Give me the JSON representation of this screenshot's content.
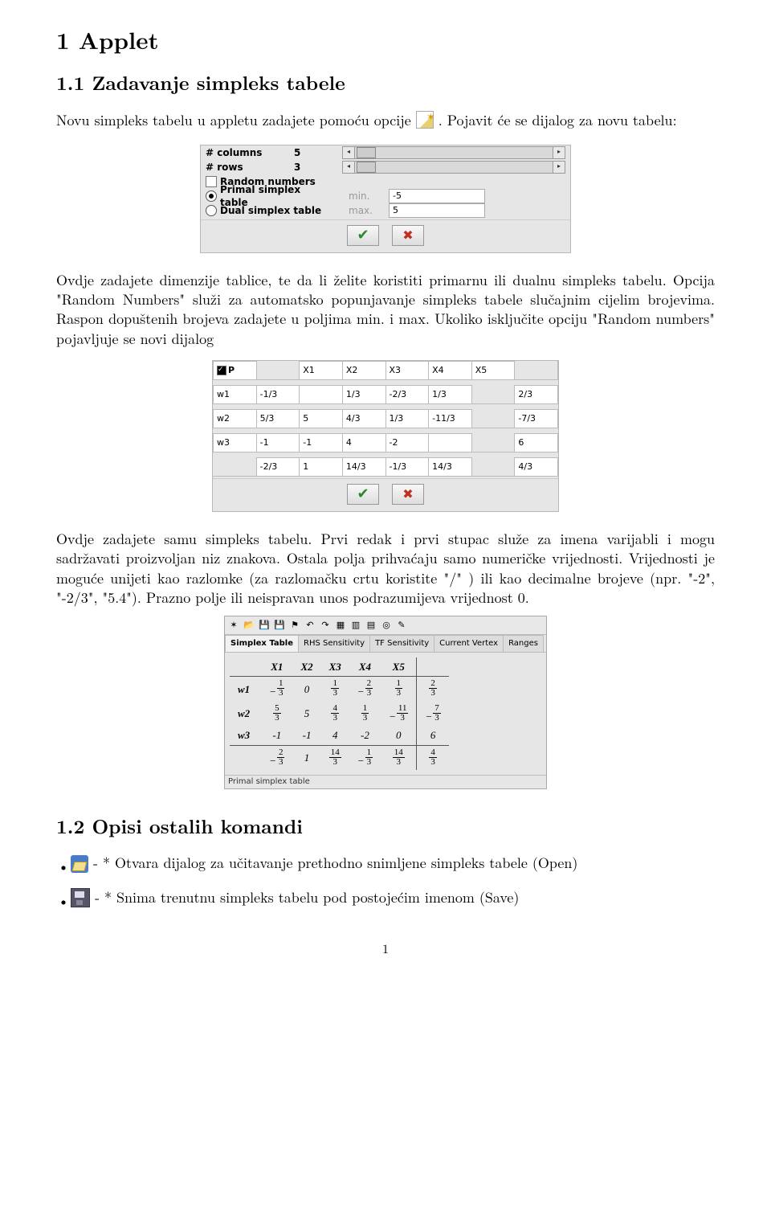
{
  "h1": "1   Applet",
  "h2_1": "1.1   Zadavanje simpleks tabele",
  "p1_a": "Novu simpleks tabelu u appletu zadajete pomoću opcije ",
  "p1_b": ". Pojavit će se dijalog za novu tabelu:",
  "dlg1": {
    "cols_label": "# columns",
    "cols_val": "5",
    "rows_label": "# rows",
    "rows_val": "3",
    "random": "Random numbers",
    "primal": "Primal simplex table",
    "dual": "Dual simplex table",
    "min": "min.",
    "max": "max.",
    "min_val": "-5",
    "max_val": "5"
  },
  "p2": "Ovdje zadajete dimenzije tablice, te da li želite koristiti primarnu ili dualnu simpleks tabelu. Opcija \"Random Numbers\" služi za automatsko popunjavanje simpleks tabele slučajnim cijelim brojevima. Raspon dopuštenih brojeva zadajete u poljima min. i max. Ukoliko isključite opciju \"Random numbers\" pojavljuje se novi dijalog",
  "dlg2": {
    "p": "P",
    "headers": [
      "X1",
      "X2",
      "X3",
      "X4",
      "X5"
    ],
    "rows": [
      {
        "name": "w1",
        "cells": [
          "-1/3",
          "",
          "1/3",
          "-2/3",
          "1/3",
          "2/3"
        ]
      },
      {
        "name": "w2",
        "cells": [
          "5/3",
          "5",
          "4/3",
          "1/3",
          "-11/3",
          "-7/3"
        ]
      },
      {
        "name": "w3",
        "cells": [
          "-1",
          "-1",
          "4",
          "-2",
          "",
          "6"
        ]
      }
    ],
    "footer": [
      "-2/3",
      "1",
      "14/3",
      "-1/3",
      "14/3",
      "4/3"
    ]
  },
  "p3": "Ovdje zadajete samu simpleks tabelu. Prvi redak i prvi stupac služe za imena varijabli i mogu sadržavati proizvoljan niz znakova. Ostala polja prihvaćaju samo numeričke vrijednosti. Vrijednosti je moguće unijeti kao razlomke (za razlomačku crtu koristite \"/\" ) ili kao decimalne brojeve (npr. \"-2\", \"-2/3\", \"5.4\"). Prazno polje ili neispravan unos podrazumijeva vrijednost 0.",
  "panel3": {
    "tabs": [
      "Simplex Table",
      "RHS Sensitivity",
      "TF Sensitivity",
      "Current Vertex",
      "Ranges"
    ],
    "cols": [
      "X1",
      "X2",
      "X3",
      "X4",
      "X5"
    ],
    "rows": [
      {
        "name": "w1",
        "cells": [
          {
            "n": -1,
            "d": 3
          },
          {
            "v": 0
          },
          {
            "n": 1,
            "d": 3
          },
          {
            "n": -2,
            "d": 3
          },
          {
            "n": 1,
            "d": 3
          },
          {
            "n": 2,
            "d": 3
          }
        ]
      },
      {
        "name": "w2",
        "cells": [
          {
            "n": 5,
            "d": 3
          },
          {
            "v": 5
          },
          {
            "n": 4,
            "d": 3
          },
          {
            "n": 1,
            "d": 3
          },
          {
            "n": -11,
            "d": 3
          },
          {
            "n": -7,
            "d": 3
          }
        ]
      },
      {
        "name": "w3",
        "cells": [
          {
            "v": -1
          },
          {
            "v": -1
          },
          {
            "v": 4
          },
          {
            "v": -2
          },
          {
            "v": 0
          },
          {
            "v": 6
          }
        ]
      }
    ],
    "footer": [
      {
        "n": -2,
        "d": 3
      },
      {
        "v": 1
      },
      {
        "n": 14,
        "d": 3
      },
      {
        "n": -1,
        "d": 3
      },
      {
        "n": 14,
        "d": 3
      },
      {
        "n": 4,
        "d": 3
      }
    ],
    "status": "Primal simplex table"
  },
  "h2_2": "1.2   Opisi ostalih komandi",
  "cmd_open": " - * Otvara dijalog za učitavanje prethodno snimljene simpleks tabele (Open)",
  "cmd_save": " - * Snima trenutnu simpleks tabelu pod postojećim imenom (Save)",
  "pagenum": "1"
}
